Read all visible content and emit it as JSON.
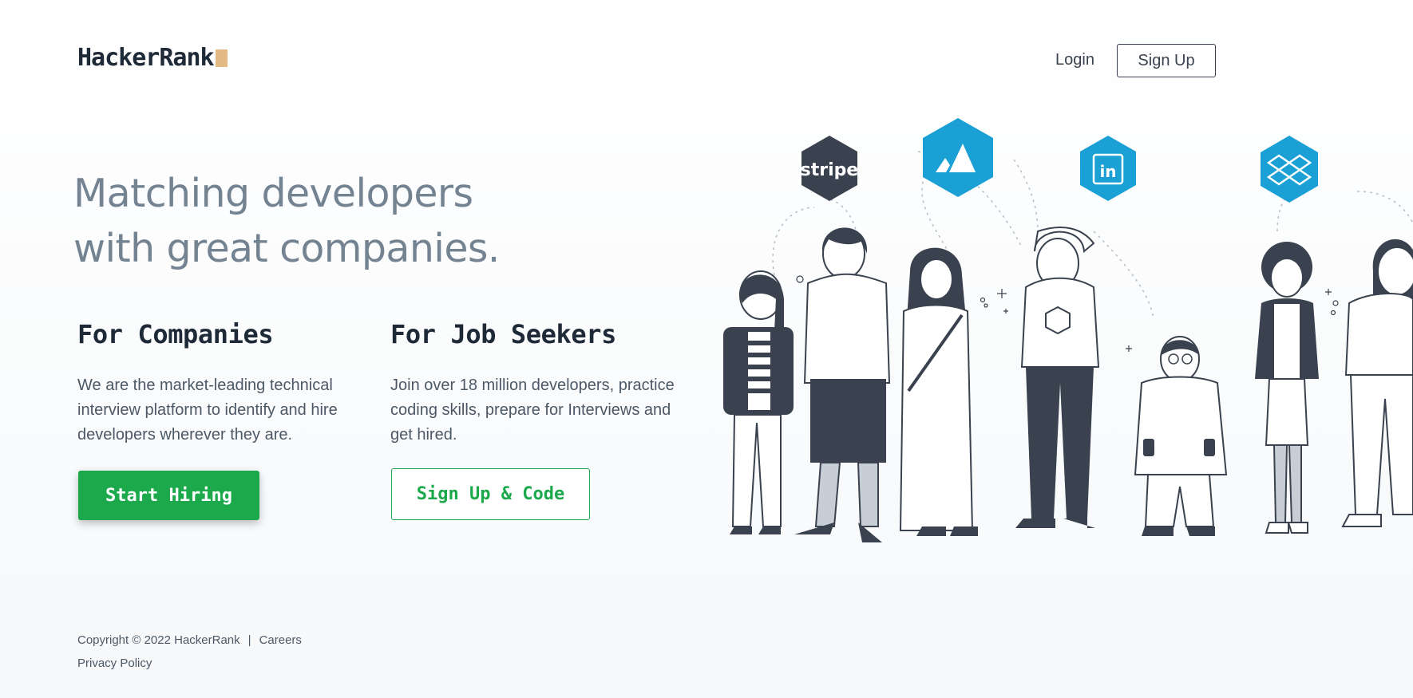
{
  "header": {
    "logo_text": "HackerRank",
    "login_label": "Login",
    "signup_label": "Sign Up"
  },
  "hero": {
    "headline_line1": "Matching developers",
    "headline_line2": "with great companies."
  },
  "companies": {
    "heading": "For Companies",
    "description": "We are the market-leading technical interview platform to identify and hire developers wherever they are.",
    "button_label": "Start Hiring"
  },
  "job_seekers": {
    "heading": "For Job Seekers",
    "description": "Join over 18 million developers, practice coding skills, prepare for Interviews and get hired.",
    "button_label": "Sign Up & Code"
  },
  "footer": {
    "copyright": "Copyright © 2022 HackerRank",
    "separator": "|",
    "careers_label": "Careers",
    "privacy_label": "Privacy Policy"
  },
  "illustration": {
    "company_badges": [
      {
        "name": "stripe-icon",
        "label": "stripe",
        "color": "#39424e"
      },
      {
        "name": "atlassian-icon",
        "label": "",
        "color": "#1ba0d5"
      },
      {
        "name": "linkedin-icon",
        "label": "in",
        "color": "#1ba0d5"
      },
      {
        "name": "dropbox-icon",
        "label": "",
        "color": "#1ba0d5"
      }
    ]
  },
  "colors": {
    "brand_green": "#1ba94c",
    "dark_navy": "#1f2a38",
    "logo_accent": "#e3b984",
    "badge_blue": "#1ba0d5"
  }
}
